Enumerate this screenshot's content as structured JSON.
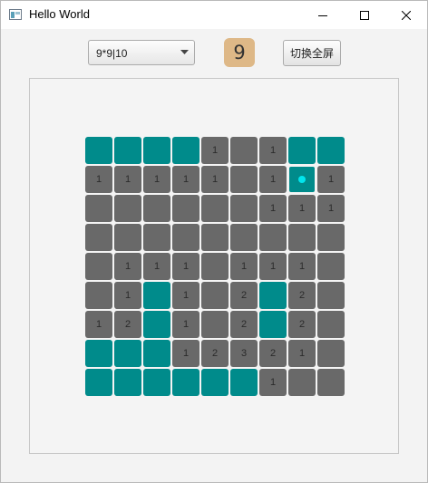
{
  "window": {
    "title": "Hello World"
  },
  "toolbar": {
    "difficulty_value": "9*9|10",
    "mine_counter": "9",
    "fullscreen_label": "切换全屏"
  },
  "colors": {
    "covered": "#008b8b",
    "open": "#696969",
    "counter_bg": "#deb887",
    "mine_dot": "#00e5ee"
  },
  "board": {
    "rows": 9,
    "cols": 9,
    "cells": [
      [
        "C",
        "C",
        "C",
        "C",
        "1",
        "O",
        "1",
        "C",
        "C"
      ],
      [
        "1",
        "1",
        "1",
        "1",
        "1",
        "O",
        "1",
        "M",
        "1"
      ],
      [
        "O",
        "O",
        "O",
        "O",
        "O",
        "O",
        "1",
        "1",
        "1"
      ],
      [
        "O",
        "O",
        "O",
        "O",
        "O",
        "O",
        "O",
        "O",
        "O"
      ],
      [
        "O",
        "1",
        "1",
        "1",
        "O",
        "1",
        "1",
        "1",
        "O"
      ],
      [
        "O",
        "1",
        "C",
        "1",
        "O",
        "2",
        "C",
        "2",
        "O"
      ],
      [
        "1",
        "2",
        "C",
        "1",
        "O",
        "2",
        "C",
        "2",
        "O"
      ],
      [
        "C",
        "C",
        "C",
        "1",
        "2",
        "3",
        "2",
        "1",
        "O"
      ],
      [
        "C",
        "C",
        "C",
        "C",
        "C",
        "C",
        "1",
        "O",
        "O"
      ]
    ]
  }
}
